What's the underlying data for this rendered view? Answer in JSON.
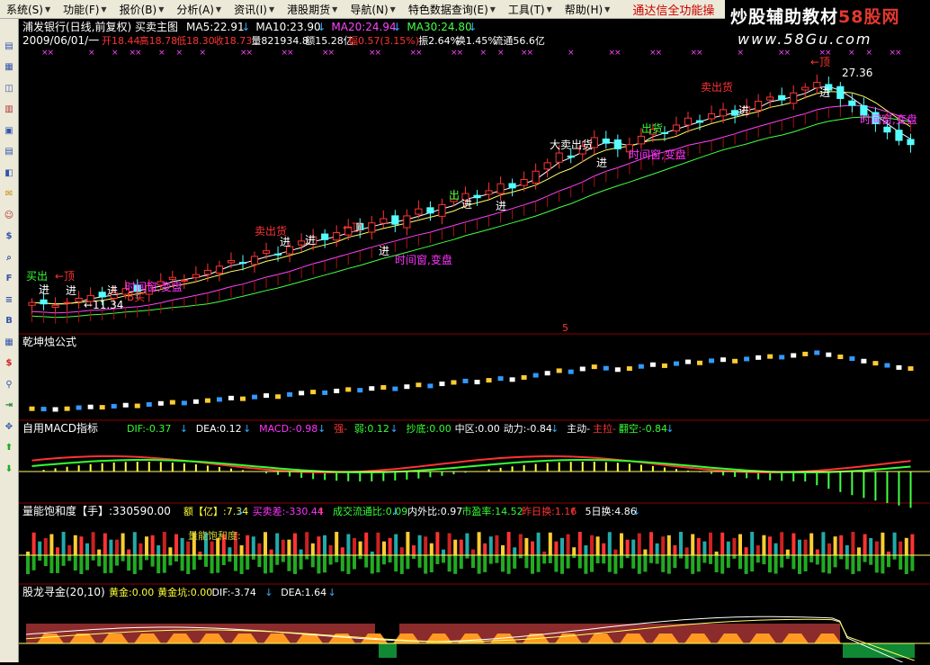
{
  "menu": [
    {
      "label": "系统(S)"
    },
    {
      "label": "功能(F)"
    },
    {
      "label": "报价(B)"
    },
    {
      "label": "分析(A)"
    },
    {
      "label": "资讯(I)"
    },
    {
      "label": "港股期货"
    },
    {
      "label": "导航(N)"
    },
    {
      "label": "特色数据查询(E)"
    },
    {
      "label": "工具(T)"
    },
    {
      "label": "帮助(H)"
    }
  ],
  "menu_hint": "通达信全功能操",
  "banner": {
    "line1a": "炒股辅助教材",
    "line1b": "58股网",
    "line2": "www.58Gu.com"
  },
  "toolbar_icons": [
    "quote-list-icon",
    "market-icon",
    "chart-icon",
    "kline-icon",
    "report-icon",
    "table-icon",
    "info-icon",
    "mail-icon",
    "users-icon",
    "dollar-chart-icon",
    "search-icon",
    "f10-icon",
    "sort-icon",
    "bsi-icon",
    "grid-icon",
    "money-icon",
    "link-icon",
    "exit-icon",
    "expand-icon",
    "arrow-up-icon",
    "arrow-down-icon"
  ],
  "main_panel": {
    "title": "浦发银行(日线,前复权) 买卖主图",
    "ma": [
      {
        "label": "MA5:22.91",
        "color": "#ffffff"
      },
      {
        "label": "MA10:23.90",
        "color": "#ffffff"
      },
      {
        "label": "MA20:24.94",
        "color": "#ff44ff"
      },
      {
        "label": "MA30:24.80",
        "color": "#44ff44"
      }
    ],
    "info_date": "2009/06/01/一",
    "info": [
      {
        "label": "开18.44",
        "color": "#ff3333"
      },
      {
        "label": "高18.78",
        "color": "#ff3333"
      },
      {
        "label": "低18.30",
        "color": "#ff3333"
      },
      {
        "label": "收18.73",
        "color": "#ff3333"
      },
      {
        "label": "量821934.8",
        "color": "#ffffff"
      },
      {
        "label": "额15.28亿",
        "color": "#ffffff"
      },
      {
        "label": "幅0.57(3.15%)",
        "color": "#ff3333"
      },
      {
        "label": "振2.64%",
        "color": "#ffffff"
      },
      {
        "label": "换1.45%",
        "color": "#ffffff"
      },
      {
        "label": "流通56.6亿",
        "color": "#ffffff"
      }
    ],
    "annotations": [
      {
        "text": "买出",
        "color": "#33ff33"
      },
      {
        "text": "←顶",
        "color": "#ff3333"
      },
      {
        "text": "进",
        "color": "#ffffff"
      },
      {
        "text": "进",
        "color": "#ffffff"
      },
      {
        "text": "B买",
        "color": "#ff3333"
      },
      {
        "text": "←11.34",
        "color": "#ffffff"
      },
      {
        "text": "进",
        "color": "#ffffff"
      },
      {
        "text": "时间窗,变盘",
        "color": "#ff33ff"
      },
      {
        "text": "卖出货",
        "color": "#ff3333"
      },
      {
        "text": "进",
        "color": "#ffffff"
      },
      {
        "text": "进",
        "color": "#ffffff"
      },
      {
        "text": "←顶",
        "color": "#ff3333"
      },
      {
        "text": "进",
        "color": "#ffffff"
      },
      {
        "text": "时间窗,变盘",
        "color": "#ff33ff"
      },
      {
        "text": "出",
        "color": "#33ff33"
      },
      {
        "text": "进",
        "color": "#ffffff"
      },
      {
        "text": "进",
        "color": "#ffffff"
      },
      {
        "text": "大卖出货",
        "color": "#ffffff"
      },
      {
        "text": "进",
        "color": "#ffffff"
      },
      {
        "text": "出货",
        "color": "#33ff33"
      },
      {
        "text": "时间窗,变盘",
        "color": "#ff33ff"
      },
      {
        "text": "卖出货",
        "color": "#ff3333"
      },
      {
        "text": "进",
        "color": "#ffffff"
      },
      {
        "text": "←顶",
        "color": "#ff3333"
      },
      {
        "text": "27.36",
        "color": "#ffffff"
      },
      {
        "text": "进",
        "color": "#ffffff"
      },
      {
        "text": "时间窗,变盘",
        "color": "#ff33ff"
      }
    ],
    "page_marker": "5"
  },
  "panel2": {
    "title": "乾坤烛公式"
  },
  "panel3": {
    "title": "自用MACD指标",
    "items": [
      {
        "label": "DIF:-0.37",
        "arrow": "↓",
        "color": "#33ff33"
      },
      {
        "label": "DEA:0.12",
        "arrow": "↓",
        "color": "#ffffff"
      },
      {
        "label": "MACD:-0.98",
        "arrow": "↓",
        "color": "#ff33ff"
      },
      {
        "label": "强-",
        "arrow": "",
        "color": "#ff3333"
      },
      {
        "label": "弱:0.12",
        "arrow": "↓",
        "color": "#33ff33"
      },
      {
        "label": "抄底:0.00",
        "arrow": "",
        "color": "#33ff33"
      },
      {
        "label": "中区:0.00",
        "arrow": "",
        "color": "#ffffff"
      },
      {
        "label": "动力:-0.84",
        "arrow": "↓",
        "color": "#ffffff"
      },
      {
        "label": "主动-",
        "arrow": "",
        "color": "#ffffff"
      },
      {
        "label": "主拉-",
        "arrow": "",
        "color": "#ff3333"
      },
      {
        "label": "翻空:-0.84",
        "arrow": "↓",
        "color": "#33ff33"
      }
    ]
  },
  "panel4": {
    "title": "量能饱和度【手】:330590.00",
    "items": [
      {
        "label": "额【亿】:7.34",
        "arrow": "↓",
        "color": "#ffff33"
      },
      {
        "label": "买卖差:-330.44",
        "arrow": "↑",
        "color": "#ff33ff"
      },
      {
        "label": "成交流通比:0.09",
        "arrow": "↓",
        "color": "#33ff33"
      },
      {
        "label": "内外比:0.97",
        "arrow": "",
        "color": "#ffffff"
      },
      {
        "label": "市盈率:14.52",
        "arrow": "",
        "color": "#33ff33"
      },
      {
        "label": "昨日换:1.16",
        "arrow": "↑",
        "color": "#ff3333"
      },
      {
        "label": "5日换:4.86",
        "arrow": "↓",
        "color": "#ffffff"
      }
    ],
    "inner_label": "量能饱和度:"
  },
  "panel5": {
    "title": "股龙寻金(20,10)",
    "items": [
      {
        "label": "黄金:0.00",
        "arrow": "",
        "color": "#ffff33"
      },
      {
        "label": "黄金坑:0.00",
        "arrow": "",
        "color": "#ffff33"
      },
      {
        "label": "DIF:-3.74",
        "arrow": "↓",
        "color": "#ffffff"
      },
      {
        "label": "DEA:1.64",
        "arrow": "↓",
        "color": "#ffffff"
      }
    ]
  },
  "chart_data": {
    "type": "candlestick",
    "series_close": [
      11.6,
      11.5,
      11.4,
      11.6,
      11.9,
      12.1,
      12.0,
      12.3,
      12.6,
      12.4,
      12.8,
      13.1,
      13.4,
      13.2,
      13.6,
      13.9,
      14.2,
      14.6,
      14.4,
      14.9,
      15.3,
      15.0,
      15.6,
      16.0,
      16.3,
      16.1,
      16.6,
      17.0,
      16.8,
      17.3,
      17.6,
      17.2,
      17.8,
      18.3,
      18.0,
      18.6,
      19.0,
      19.4,
      19.1,
      19.6,
      20.1,
      19.8,
      20.4,
      21.0,
      21.6,
      22.3,
      22.0,
      22.8,
      23.4,
      23.0,
      22.6,
      22.9,
      23.5,
      24.0,
      23.7,
      24.3,
      24.8,
      24.5,
      25.1,
      25.4,
      25.0,
      25.6,
      26.0,
      26.3,
      26.1,
      26.6,
      27.0,
      27.36,
      26.8,
      26.2,
      25.7,
      25.0,
      24.4,
      23.8,
      23.2,
      22.9
    ],
    "ylim": [
      10,
      29
    ]
  }
}
